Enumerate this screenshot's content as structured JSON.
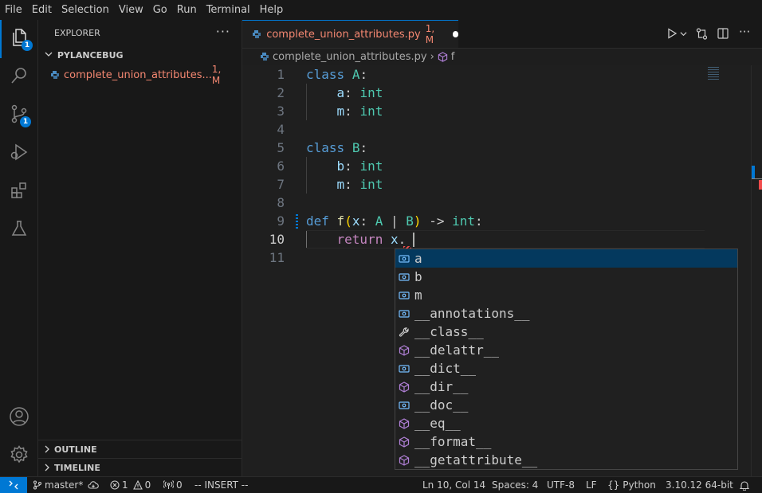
{
  "menu": [
    "File",
    "Edit",
    "Selection",
    "View",
    "Go",
    "Run",
    "Terminal",
    "Help"
  ],
  "activity": {
    "explorer_badge": "1",
    "scm_badge": "1"
  },
  "sidebar": {
    "title": "EXPLORER",
    "more": "···",
    "folder": "PYLANCEBUG",
    "file_name": "complete_union_attributes...",
    "file_status": "1, M",
    "outline": "OUTLINE",
    "timeline": "TIMELINE"
  },
  "tab": {
    "name": "complete_union_attributes.py",
    "status": "1, M"
  },
  "breadcrumb": {
    "file": "complete_union_attributes.py",
    "sep": "›",
    "symbol": "f"
  },
  "code": {
    "line_numbers": [
      "1",
      "2",
      "3",
      "4",
      "5",
      "6",
      "7",
      "8",
      "9",
      "10",
      "11"
    ]
  },
  "suggest": {
    "items": [
      {
        "label": "a",
        "icon": "field-icon"
      },
      {
        "label": "b",
        "icon": "field-icon"
      },
      {
        "label": "m",
        "icon": "field-icon"
      },
      {
        "label": "__annotations__",
        "icon": "field-icon"
      },
      {
        "label": "__class__",
        "icon": "wrench-icon"
      },
      {
        "label": "__delattr__",
        "icon": "method-icon"
      },
      {
        "label": "__dict__",
        "icon": "field-icon"
      },
      {
        "label": "__dir__",
        "icon": "method-icon"
      },
      {
        "label": "__doc__",
        "icon": "field-icon"
      },
      {
        "label": "__eq__",
        "icon": "method-icon"
      },
      {
        "label": "__format__",
        "icon": "method-icon"
      },
      {
        "label": "__getattribute__",
        "icon": "method-icon"
      }
    ]
  },
  "status": {
    "branch": "master*",
    "errors": "1",
    "warnings": "0",
    "ports": "0",
    "mode": "-- INSERT --",
    "position": "Ln 10, Col 14",
    "spaces": "Spaces: 4",
    "encoding": "UTF-8",
    "eol": "LF",
    "language": "Python",
    "interpreter": "3.10.12 64-bit"
  },
  "colors": {
    "accent": "#0078d4",
    "modified": "#f48771",
    "selection": "#04395e"
  }
}
